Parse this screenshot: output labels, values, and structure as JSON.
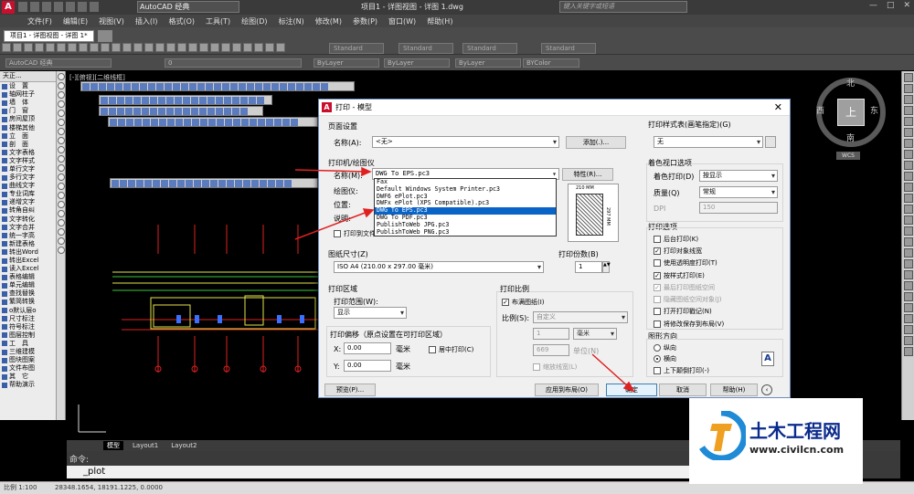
{
  "titlebar": {
    "workspace": "AutoCAD 经典",
    "title": "项目1 - 详图视图 - 详图 1.dwg",
    "search_placeholder": "键入关键字或短语",
    "min": "—",
    "max": "□",
    "close": "✕"
  },
  "menu": [
    "文件(F)",
    "编辑(E)",
    "视图(V)",
    "插入(I)",
    "格式(O)",
    "工具(T)",
    "绘图(D)",
    "标注(N)",
    "修改(M)",
    "参数(P)",
    "窗口(W)",
    "帮助(H)"
  ],
  "doc_tabs": [
    "项目1 - 详图视图 - 详图 1*",
    ""
  ],
  "toolbar": {
    "workspace2": "AutoCAD 经典",
    "layer_value": "0",
    "styles": [
      "Standard",
      "Standard",
      "Standard",
      "Standard"
    ],
    "bylayer1": "ByLayer",
    "bylayer2": "ByLayer",
    "bylayer3": "ByLayer",
    "bycolor": "BYColor"
  },
  "palette": {
    "header": "天正...",
    "items": [
      "设　置",
      "轴网柱子",
      "墙　体",
      "门　窗",
      "房间屋顶",
      "楼梯其他",
      "立　面",
      "剖　面",
      "文字表格",
      "文字样式",
      "单行文字",
      "多行文字",
      "曲线文字",
      "专业词库",
      "递增文字",
      "转角自纠",
      "文字转化",
      "文字合并",
      "统一字高",
      "新建表格",
      "转出Word",
      "转出Excel",
      "读入Excel",
      "表格编辑",
      "单元编辑",
      "查找替换",
      "繁简转换",
      "o默认层o",
      "尺寸标注",
      "符号标注",
      "图层控制",
      "工　具",
      "三维建模",
      "图块图案",
      "文件布图",
      "其　它",
      "帮助演示"
    ]
  },
  "viewport_label": "[-][俯视][二维线框]",
  "viewcube": {
    "north": "北",
    "south": "南",
    "east": "东",
    "west": "西",
    "top": "上",
    "wcs": "WCS"
  },
  "layout_tabs": [
    "模型",
    "Layout1",
    "Layout2"
  ],
  "command": {
    "history": "命令:",
    "current": "_plot"
  },
  "status": {
    "scale": "比例 1:100",
    "coords": "28348.1654, 18191.1225, 0.0000"
  },
  "dialog": {
    "title": "打印 - 模型",
    "page_setup": {
      "group": "页面设置",
      "name_label": "名称(A):",
      "name_value": "<无>",
      "add_button": "添加(.)..."
    },
    "plotter": {
      "group": "打印机/绘图仪",
      "name_label": "名称(M):",
      "name_value": "DWG To EPS.pc3",
      "properties_button": "特性(R)...",
      "plotter_label": "绘图仪:",
      "location_label": "位置:",
      "desc_label": "说明:",
      "print_to_file": "打印到文件(F)",
      "paper_w": "210 MM",
      "paper_h": "297 MM"
    },
    "dropdown_items": [
      "Fax",
      "Default Windows System Printer.pc3",
      "DWF6 ePlot.pc3",
      "DWFx ePlot (XPS Compatible).pc3",
      "DWG To EPS.pc3",
      "DWG To PDF.pc3",
      "PublishToWeb JPG.pc3",
      "PublishToWeb PNG.pc3"
    ],
    "dropdown_selected_index": 4,
    "paper_size": {
      "group": "图纸尺寸(Z)",
      "value": "ISO A4 (210.00 x 297.00 毫米)"
    },
    "copies": {
      "group": "打印份数(B)",
      "value": "1"
    },
    "area": {
      "group": "打印区域",
      "range_label": "打印范围(W):",
      "range_value": "显示"
    },
    "offset": {
      "group": "打印偏移（原点设置在可打印区域）",
      "x_label": "X:",
      "x_value": "0.00",
      "x_unit": "毫米",
      "y_label": "Y:",
      "y_value": "0.00",
      "y_unit": "毫米",
      "center": "居中打印(C)"
    },
    "scale": {
      "group": "打印比例",
      "fit": "布满图纸(I)",
      "scale_label": "比例(S):",
      "scale_value": "自定义",
      "v1": "1",
      "unit": "毫米",
      "v2": "669",
      "unit2": "单位(N)",
      "lineweights": "缩放线宽(L)"
    },
    "style_table": {
      "group": "打印样式表(画笔指定)(G)",
      "value": "无"
    },
    "shaded": {
      "group": "着色视口选项",
      "shade_label": "着色打印(D)",
      "shade_value": "按显示",
      "quality_label": "质量(Q)",
      "quality_value": "常规",
      "dpi_label": "DPI",
      "dpi_value": "150"
    },
    "options": {
      "group": "打印选项",
      "items": [
        {
          "label": "后台打印(K)",
          "checked": false,
          "disabled": false
        },
        {
          "label": "打印对象线宽",
          "checked": true,
          "disabled": false
        },
        {
          "label": "使用透明度打印(T)",
          "checked": false,
          "disabled": false
        },
        {
          "label": "按样式打印(E)",
          "checked": true,
          "disabled": false
        },
        {
          "label": "最后打印图纸空间",
          "checked": true,
          "disabled": true
        },
        {
          "label": "隐藏图纸空间对象(J)",
          "checked": false,
          "disabled": true
        },
        {
          "label": "打开打印戳记(N)",
          "checked": false,
          "disabled": false
        },
        {
          "label": "将修改保存到布局(V)",
          "checked": false,
          "disabled": false
        }
      ]
    },
    "orientation": {
      "group": "图形方向",
      "portrait": "纵向",
      "landscape": "横向",
      "upside": "上下颠倒打印(-)"
    },
    "buttons": {
      "preview": "预览(P)...",
      "apply": "应用到布局(O)",
      "ok": "确定",
      "cancel": "取消",
      "help": "帮助(H)"
    }
  },
  "watermark": {
    "name": "土木工程网",
    "url": "www.civilcn.com"
  },
  "colors": {
    "accent_red": "#e02020",
    "selection_blue": "#0a64c8",
    "cad_yellow": "#e5e54a",
    "cad_red": "#d82020",
    "cad_green": "#3cc83c"
  }
}
